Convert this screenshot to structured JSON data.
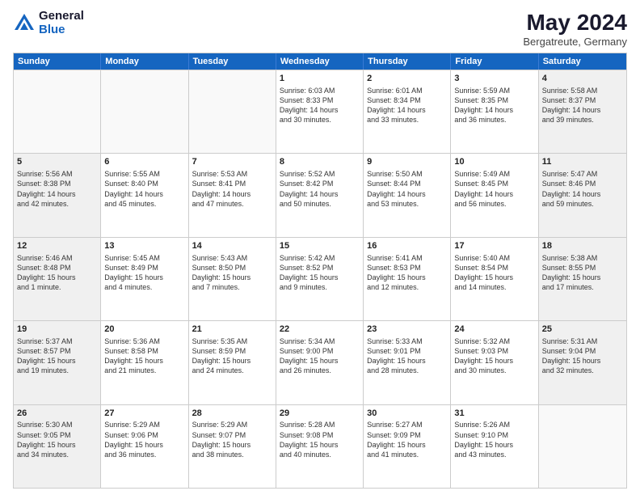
{
  "logo": {
    "general": "General",
    "blue": "Blue"
  },
  "header": {
    "month_year": "May 2024",
    "location": "Bergatreute, Germany"
  },
  "weekdays": [
    "Sunday",
    "Monday",
    "Tuesday",
    "Wednesday",
    "Thursday",
    "Friday",
    "Saturday"
  ],
  "weeks": [
    [
      {
        "day": "",
        "info": "",
        "empty": true
      },
      {
        "day": "",
        "info": "",
        "empty": true
      },
      {
        "day": "",
        "info": "",
        "empty": true
      },
      {
        "day": "1",
        "info": "Sunrise: 6:03 AM\nSunset: 8:33 PM\nDaylight: 14 hours\nand 30 minutes."
      },
      {
        "day": "2",
        "info": "Sunrise: 6:01 AM\nSunset: 8:34 PM\nDaylight: 14 hours\nand 33 minutes."
      },
      {
        "day": "3",
        "info": "Sunrise: 5:59 AM\nSunset: 8:35 PM\nDaylight: 14 hours\nand 36 minutes."
      },
      {
        "day": "4",
        "info": "Sunrise: 5:58 AM\nSunset: 8:37 PM\nDaylight: 14 hours\nand 39 minutes."
      }
    ],
    [
      {
        "day": "5",
        "info": "Sunrise: 5:56 AM\nSunset: 8:38 PM\nDaylight: 14 hours\nand 42 minutes."
      },
      {
        "day": "6",
        "info": "Sunrise: 5:55 AM\nSunset: 8:40 PM\nDaylight: 14 hours\nand 45 minutes."
      },
      {
        "day": "7",
        "info": "Sunrise: 5:53 AM\nSunset: 8:41 PM\nDaylight: 14 hours\nand 47 minutes."
      },
      {
        "day": "8",
        "info": "Sunrise: 5:52 AM\nSunset: 8:42 PM\nDaylight: 14 hours\nand 50 minutes."
      },
      {
        "day": "9",
        "info": "Sunrise: 5:50 AM\nSunset: 8:44 PM\nDaylight: 14 hours\nand 53 minutes."
      },
      {
        "day": "10",
        "info": "Sunrise: 5:49 AM\nSunset: 8:45 PM\nDaylight: 14 hours\nand 56 minutes."
      },
      {
        "day": "11",
        "info": "Sunrise: 5:47 AM\nSunset: 8:46 PM\nDaylight: 14 hours\nand 59 minutes."
      }
    ],
    [
      {
        "day": "12",
        "info": "Sunrise: 5:46 AM\nSunset: 8:48 PM\nDaylight: 15 hours\nand 1 minute."
      },
      {
        "day": "13",
        "info": "Sunrise: 5:45 AM\nSunset: 8:49 PM\nDaylight: 15 hours\nand 4 minutes."
      },
      {
        "day": "14",
        "info": "Sunrise: 5:43 AM\nSunset: 8:50 PM\nDaylight: 15 hours\nand 7 minutes."
      },
      {
        "day": "15",
        "info": "Sunrise: 5:42 AM\nSunset: 8:52 PM\nDaylight: 15 hours\nand 9 minutes."
      },
      {
        "day": "16",
        "info": "Sunrise: 5:41 AM\nSunset: 8:53 PM\nDaylight: 15 hours\nand 12 minutes."
      },
      {
        "day": "17",
        "info": "Sunrise: 5:40 AM\nSunset: 8:54 PM\nDaylight: 15 hours\nand 14 minutes."
      },
      {
        "day": "18",
        "info": "Sunrise: 5:38 AM\nSunset: 8:55 PM\nDaylight: 15 hours\nand 17 minutes."
      }
    ],
    [
      {
        "day": "19",
        "info": "Sunrise: 5:37 AM\nSunset: 8:57 PM\nDaylight: 15 hours\nand 19 minutes."
      },
      {
        "day": "20",
        "info": "Sunrise: 5:36 AM\nSunset: 8:58 PM\nDaylight: 15 hours\nand 21 minutes."
      },
      {
        "day": "21",
        "info": "Sunrise: 5:35 AM\nSunset: 8:59 PM\nDaylight: 15 hours\nand 24 minutes."
      },
      {
        "day": "22",
        "info": "Sunrise: 5:34 AM\nSunset: 9:00 PM\nDaylight: 15 hours\nand 26 minutes."
      },
      {
        "day": "23",
        "info": "Sunrise: 5:33 AM\nSunset: 9:01 PM\nDaylight: 15 hours\nand 28 minutes."
      },
      {
        "day": "24",
        "info": "Sunrise: 5:32 AM\nSunset: 9:03 PM\nDaylight: 15 hours\nand 30 minutes."
      },
      {
        "day": "25",
        "info": "Sunrise: 5:31 AM\nSunset: 9:04 PM\nDaylight: 15 hours\nand 32 minutes."
      }
    ],
    [
      {
        "day": "26",
        "info": "Sunrise: 5:30 AM\nSunset: 9:05 PM\nDaylight: 15 hours\nand 34 minutes."
      },
      {
        "day": "27",
        "info": "Sunrise: 5:29 AM\nSunset: 9:06 PM\nDaylight: 15 hours\nand 36 minutes."
      },
      {
        "day": "28",
        "info": "Sunrise: 5:29 AM\nSunset: 9:07 PM\nDaylight: 15 hours\nand 38 minutes."
      },
      {
        "day": "29",
        "info": "Sunrise: 5:28 AM\nSunset: 9:08 PM\nDaylight: 15 hours\nand 40 minutes."
      },
      {
        "day": "30",
        "info": "Sunrise: 5:27 AM\nSunset: 9:09 PM\nDaylight: 15 hours\nand 41 minutes."
      },
      {
        "day": "31",
        "info": "Sunrise: 5:26 AM\nSunset: 9:10 PM\nDaylight: 15 hours\nand 43 minutes."
      },
      {
        "day": "",
        "info": "",
        "empty": true
      }
    ]
  ]
}
